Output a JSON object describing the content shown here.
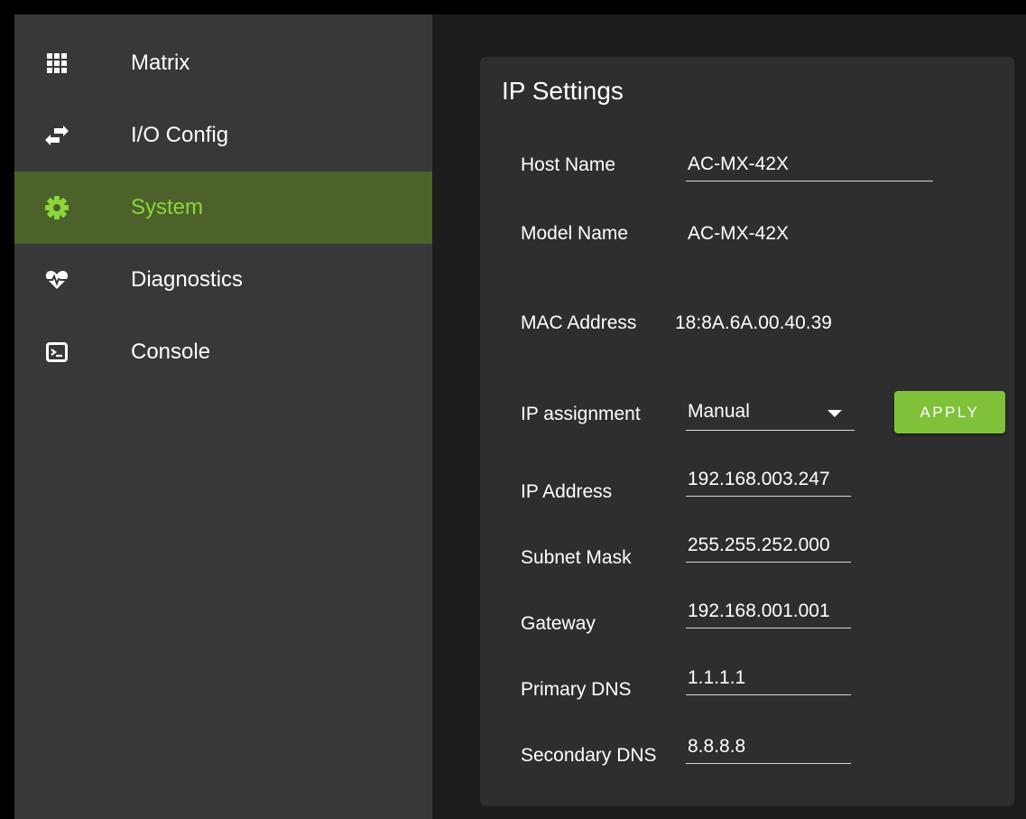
{
  "sidebar": {
    "items": [
      {
        "label": "Matrix",
        "icon": "grid-icon"
      },
      {
        "label": "I/O Config",
        "icon": "swap-arrows-icon"
      },
      {
        "label": "System",
        "icon": "gear-icon",
        "active": true
      },
      {
        "label": "Diagnostics",
        "icon": "heart-pulse-icon"
      },
      {
        "label": "Console",
        "icon": "terminal-icon"
      }
    ]
  },
  "ip_settings": {
    "title": "IP Settings",
    "host_name": {
      "label": "Host Name",
      "value": "AC-MX-42X"
    },
    "model_name": {
      "label": "Model Name",
      "value": "AC-MX-42X"
    },
    "mac_address": {
      "label": "MAC Address",
      "value": "18:8A.6A.00.40.39"
    },
    "ip_assignment": {
      "label": "IP assignment",
      "value": "Manual"
    },
    "apply_label": "APPLY",
    "ip_address": {
      "label": "IP Address",
      "value": "192.168.003.247"
    },
    "subnet_mask": {
      "label": "Subnet Mask",
      "value": "255.255.252.000"
    },
    "gateway": {
      "label": "Gateway",
      "value": "192.168.001.001"
    },
    "primary_dns": {
      "label": "Primary DNS",
      "value": "1.1.1.1"
    },
    "secondary_dns": {
      "label": "Secondary DNS",
      "value": "8.8.8.8"
    }
  },
  "colors": {
    "accent": "#8cd63a",
    "active_bg": "#4c622a",
    "button": "#80c13a",
    "sidebar_bg": "#383838",
    "panel_bg": "#2e2e2e"
  }
}
